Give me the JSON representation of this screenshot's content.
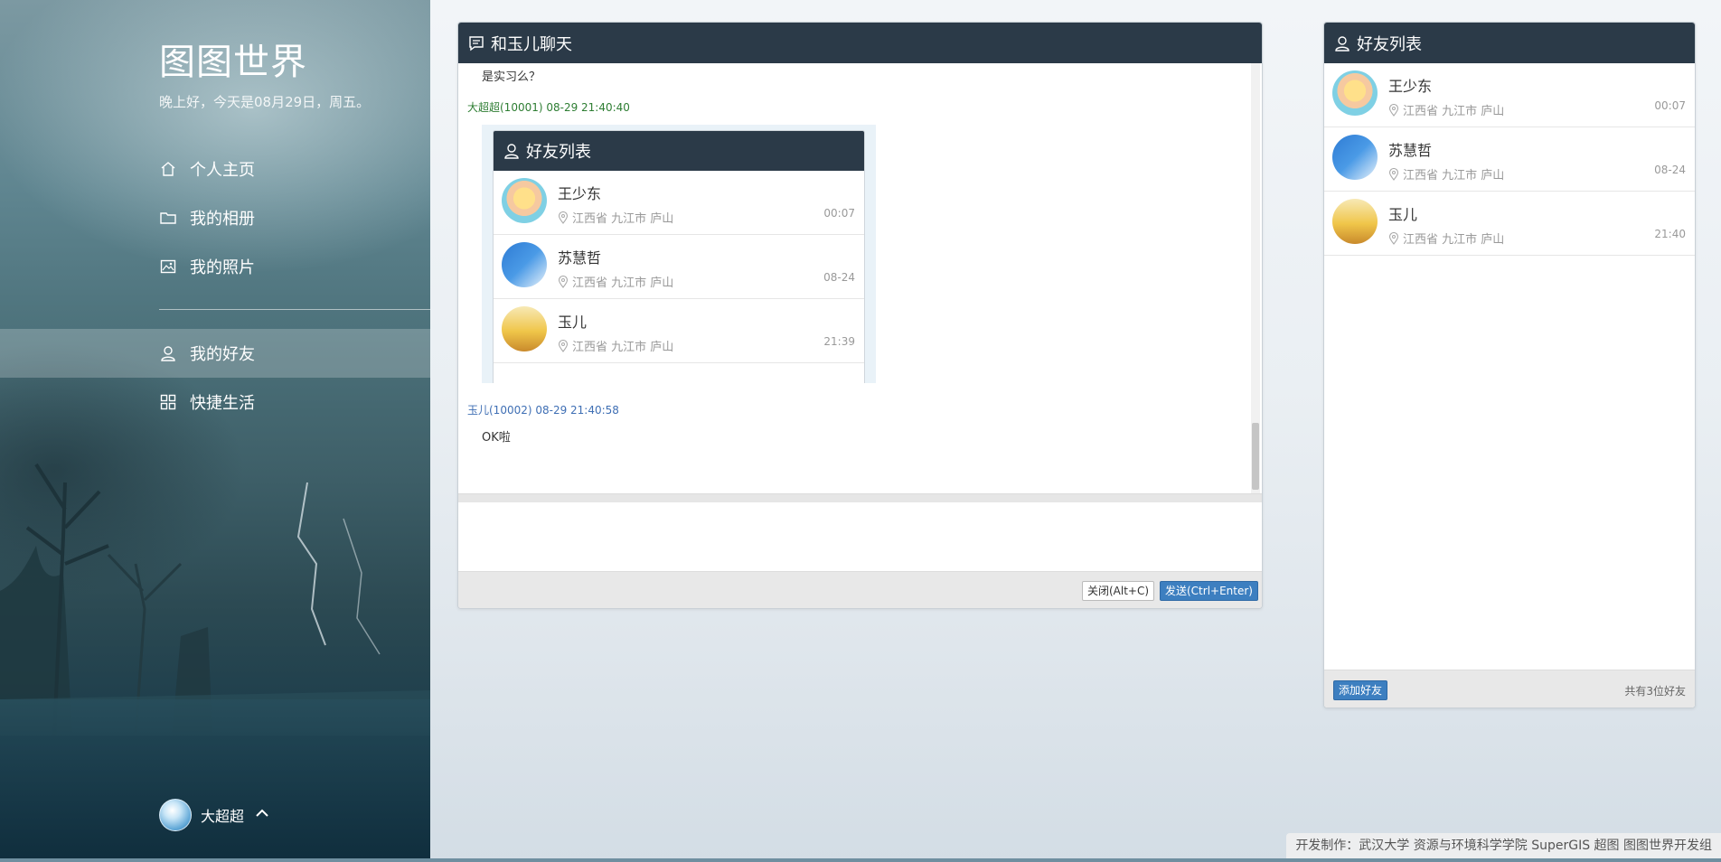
{
  "sidebar": {
    "brand": "图图世界",
    "greeting": "晚上好，今天是08月29日，周五。",
    "nav": [
      {
        "label": "个人主页",
        "icon": "home-icon"
      },
      {
        "label": "我的相册",
        "icon": "folder-icon"
      },
      {
        "label": "我的照片",
        "icon": "image-icon"
      },
      {
        "label": "我的好友",
        "icon": "user-icon",
        "active": true
      },
      {
        "label": "快捷生活",
        "icon": "grid-icon"
      }
    ],
    "user": {
      "name": "大超超",
      "chevron": "^"
    }
  },
  "chat": {
    "title": "和玉儿聊天",
    "messages": {
      "m1_text": "是实习么？",
      "m2_meta": "大超超(10001) 08-29 21:40:40",
      "m3_meta": "玉儿(10002) 08-29 21:40:58",
      "m3_text": "OK啦"
    },
    "embedded": {
      "title": "好友列表",
      "friends": [
        {
          "name": "王少东",
          "location": "江西省 九江市 庐山",
          "time": "00:07"
        },
        {
          "name": "苏慧哲",
          "location": "江西省 九江市 庐山",
          "time": "08-24"
        },
        {
          "name": "玉儿",
          "location": "江西省 九江市 庐山",
          "time": "21:39"
        }
      ]
    },
    "input_placeholder": "",
    "close_label": "关闭(Alt+C)",
    "send_label": "发送(Ctrl+Enter)"
  },
  "friends": {
    "title": "好友列表",
    "items": [
      {
        "name": "王少东",
        "location": "江西省 九江市 庐山",
        "time": "00:07"
      },
      {
        "name": "苏慧哲",
        "location": "江西省 九江市 庐山",
        "time": "08-24"
      },
      {
        "name": "玉儿",
        "location": "江西省 九江市 庐山",
        "time": "21:40"
      }
    ],
    "add_label": "添加好友",
    "count_label": "共有3位好友"
  },
  "footer": {
    "credits": "开发制作：武汉大学 资源与环境科学学院 SuperGIS 超图 图图世界开发组"
  },
  "colors": {
    "panel_header": "#2b3a48",
    "primary_button": "#3d7fc0",
    "meta_green": "#2d7d32",
    "meta_blue": "#3f6fb4"
  }
}
